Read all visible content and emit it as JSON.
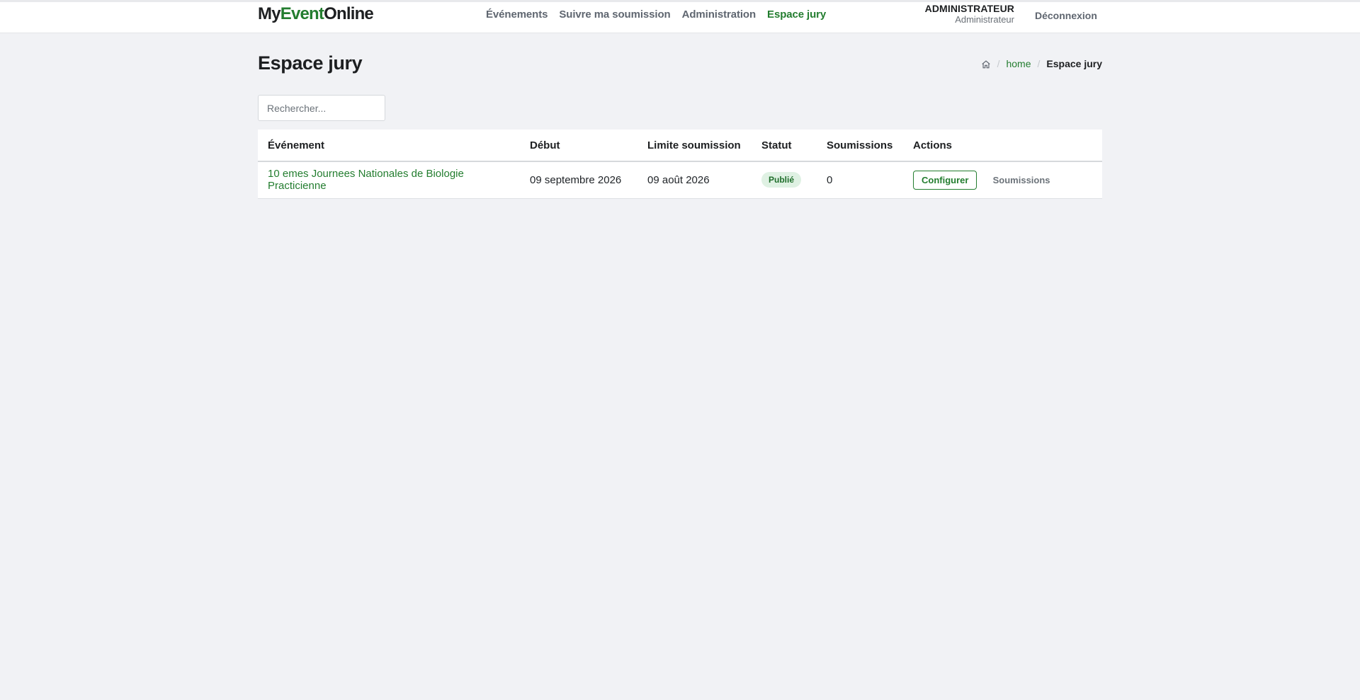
{
  "header": {
    "logo": {
      "part1": "My",
      "part2": "Event",
      "part3": "Online"
    },
    "nav": [
      {
        "label": "Événements",
        "active": false
      },
      {
        "label": "Suivre ma soumission",
        "active": false
      },
      {
        "label": "Administration",
        "active": false
      },
      {
        "label": "Espace jury",
        "active": true
      }
    ],
    "user": {
      "role": "ADMINISTRATEUR",
      "name": "Administrateur"
    },
    "logout_label": "Déconnexion"
  },
  "page": {
    "title": "Espace jury",
    "breadcrumb": {
      "home_icon": "home-icon",
      "home_label": "home",
      "current": "Espace jury"
    }
  },
  "search": {
    "placeholder": "Rechercher...",
    "value": ""
  },
  "table": {
    "headers": {
      "event": "Événement",
      "start": "Début",
      "deadline": "Limite soumission",
      "status": "Statut",
      "submissions": "Soumissions",
      "actions": "Actions"
    },
    "rows": [
      {
        "event": "10 emes Journees Nationales de Biologie Practicienne",
        "start": "09 septembre 2026",
        "deadline": "09 août 2026",
        "status": "Publié",
        "submissions": "0",
        "configure_label": "Configurer",
        "submissions_label": "Soumissions"
      }
    ]
  },
  "colors": {
    "accent": "#237d2f",
    "background": "#f1f2f5",
    "badge_bg": "#dff1e3"
  }
}
